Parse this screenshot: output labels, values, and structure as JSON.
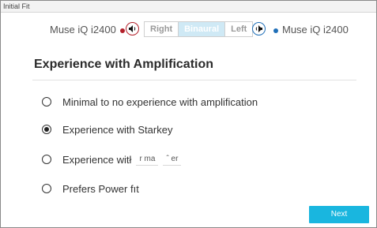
{
  "window": {
    "title": "Initial Fit"
  },
  "device_bar": {
    "left_device": "Muse iQ i2400",
    "right_device": "Muse iQ i2400",
    "left_color": "#b3202a",
    "right_color": "#1f6fb8",
    "left_speaker_icon": "speaker-left-icon",
    "right_speaker_icon": "speaker-right-icon",
    "segments": [
      "Right",
      "Binaural",
      "Left"
    ],
    "selected_segment": "Binaural"
  },
  "section": {
    "title": "Experience with Amplification"
  },
  "options": [
    {
      "label": "Minimal to no experience with amplification",
      "checked": false
    },
    {
      "label": "Experience with Starkey",
      "checked": true
    },
    {
      "label": "Experience witł",
      "checked": false,
      "dropdown_text_1": "r ma",
      "dropdown_text_2": "ˆ   er"
    },
    {
      "label": "Prefers Power fıt",
      "checked": false
    }
  ],
  "footer": {
    "next_label": "Next",
    "accent": "#19b6df"
  }
}
